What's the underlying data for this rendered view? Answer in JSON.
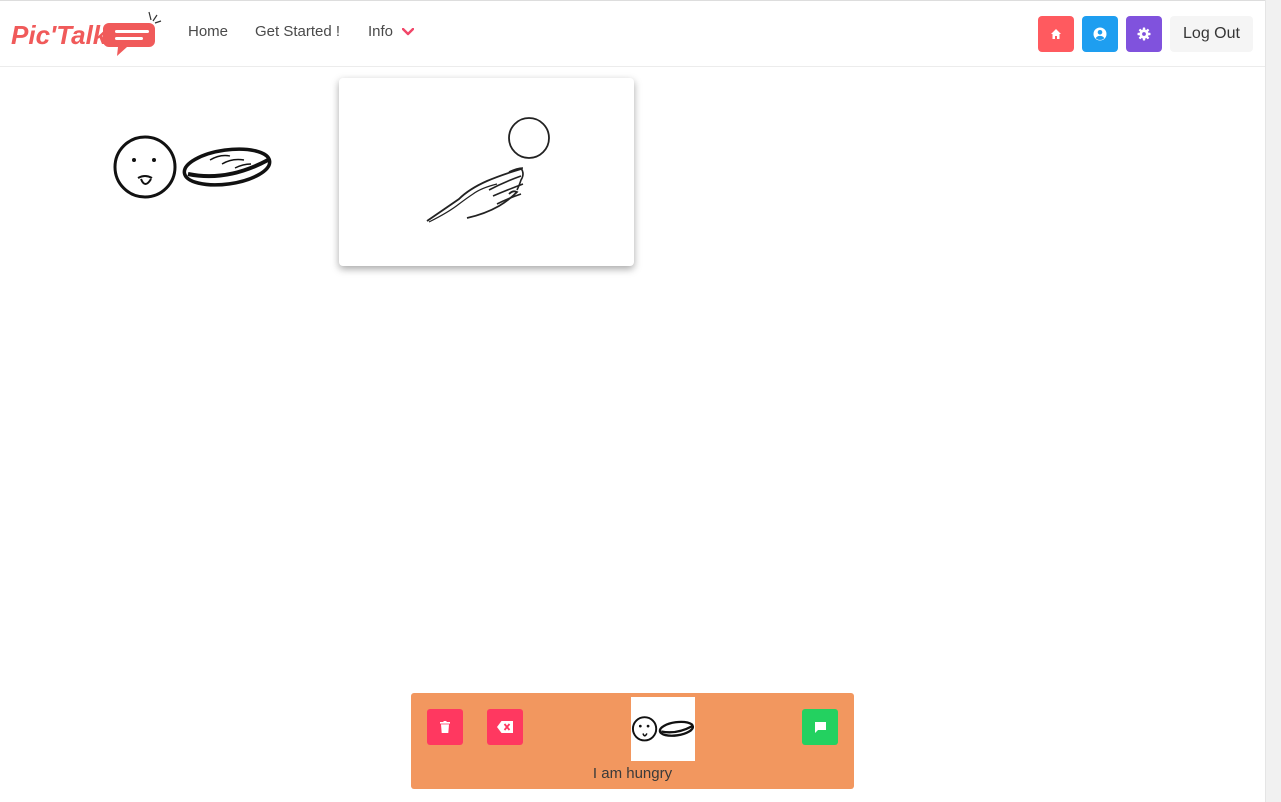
{
  "app": {
    "logo_text": "Pic'Talk"
  },
  "nav": {
    "home_label": "Home",
    "get_started_label": "Get Started !",
    "info_label": "Info"
  },
  "toolbar": {
    "home_button": "home-icon",
    "profile_button": "user-circle-icon",
    "settings_button": "gear-icon",
    "logout_label": "Log Out"
  },
  "colors": {
    "brand": "#f05a5a",
    "home_button": "#ff5a5f",
    "profile_button": "#1e9ef0",
    "settings_button": "#8052dd",
    "sentence_bar": "#f2975f",
    "clear_button": "#ff3860",
    "backspace_button": "#ff3860",
    "speak_button": "#23d160"
  },
  "pictograms": [
    {
      "name": "hungry",
      "icon": "face-and-bread-pictogram"
    },
    {
      "name": "give",
      "icon": "hand-and-ball-pictogram"
    }
  ],
  "sentence_bar": {
    "clear_icon": "trash-icon",
    "backspace_icon": "backspace-icon",
    "speak_icon": "speech-bubble-icon",
    "sentence_text": "I am hungry"
  }
}
